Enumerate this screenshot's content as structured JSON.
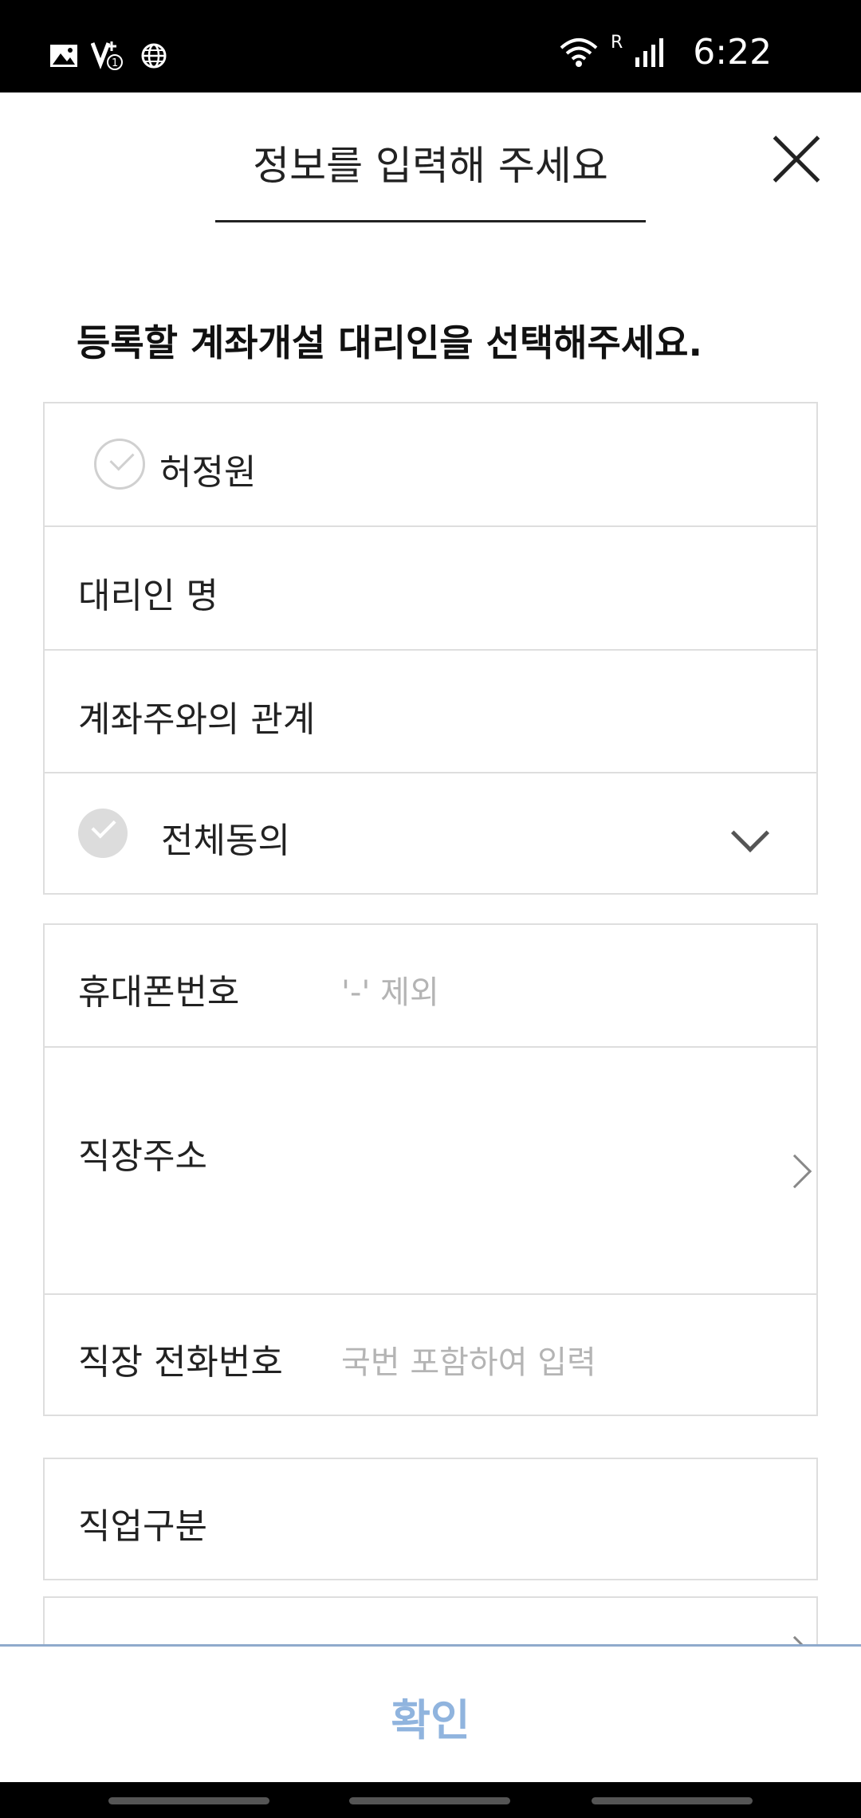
{
  "status_bar": {
    "time": "6:22",
    "network_label": "R",
    "left_icons": [
      "gallery-icon",
      "volte-icon",
      "globe-icon"
    ],
    "right_icons": [
      "wifi-icon",
      "signal-icon"
    ]
  },
  "header": {
    "title": "정보를 입력해 주세요"
  },
  "section": {
    "title": "등록할 계좌개설 대리인을 선택해주세요."
  },
  "agent_card": {
    "selected_name": "허정원",
    "agent_name_label": "대리인 명",
    "relation_label": "계좌주와의 관계",
    "agree_all_label": "전체동의"
  },
  "contact_card": {
    "phone_label": "휴대폰번호",
    "phone_placeholder": "'-' 제외",
    "work_address_label": "직장주소",
    "work_phone_label": "직장 전화번호",
    "work_phone_placeholder": "국번 포함하여 입력"
  },
  "job_card": {
    "job_type_label": "직업구분"
  },
  "footer": {
    "confirm_label": "확인"
  },
  "colors": {
    "accent_light_blue": "#90b4de",
    "divider": "#dedede",
    "placeholder": "#b4b4b4"
  }
}
